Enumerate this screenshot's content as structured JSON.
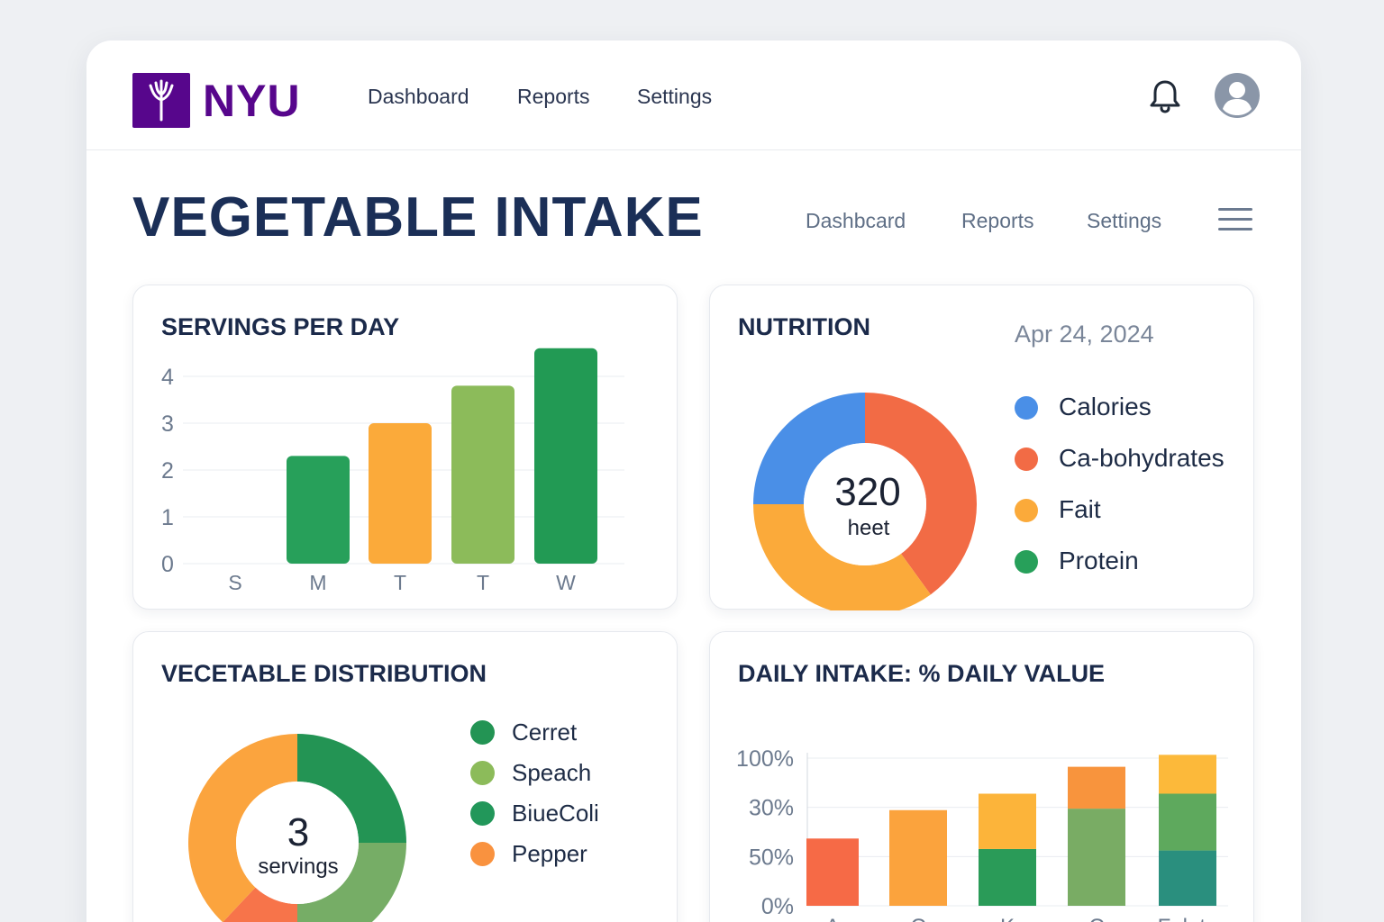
{
  "header": {
    "logo_text": "NYU",
    "nav": [
      "Dashboard",
      "Reports",
      "Settings"
    ]
  },
  "page": {
    "title": "VEGETABLE INTAKE",
    "subnav": [
      "Dashbcard",
      "Reports",
      "Settings"
    ]
  },
  "servings_card": {
    "title": "SERVINGS PER DAY"
  },
  "nutrition_card": {
    "title": "NUTRITION",
    "date": "Apr 24, 2024",
    "center_value": "320",
    "center_label": "heet",
    "legend": [
      {
        "label": "Calories",
        "color": "#4a8fe7"
      },
      {
        "label": "Ca-bohydrates",
        "color": "#f26b45"
      },
      {
        "label": "Fait",
        "color": "#fbaa3a"
      },
      {
        "label": "Protein",
        "color": "#27a05a"
      }
    ]
  },
  "distribution_card": {
    "title": "VECETABLE DISTRIBUTION",
    "center_value": "3",
    "center_label": "servings",
    "legend": [
      {
        "label": "Cerret",
        "color": "#239454"
      },
      {
        "label": "Speach",
        "color": "#8cbb5a"
      },
      {
        "label": "BiueColi",
        "color": "#22975a"
      },
      {
        "label": "Pepper",
        "color": "#f9923f"
      }
    ]
  },
  "daily_card": {
    "title": "DAILY INTAKE: % DAILY VALUE"
  },
  "chart_data": [
    {
      "type": "bar",
      "title": "SERVINGS PER DAY",
      "categories": [
        "S",
        "M",
        "T",
        "T",
        "W"
      ],
      "values": [
        0,
        2.3,
        3.0,
        3.8,
        4.6
      ],
      "colors": [
        "#27a05a",
        "#27a05a",
        "#fbaa3a",
        "#8cbb5a",
        "#229a54"
      ],
      "yticks": [
        "0",
        "1",
        "2",
        "3",
        "4"
      ],
      "ylim": [
        0,
        4.6
      ],
      "grid": true
    },
    {
      "type": "pie",
      "title": "NUTRITION",
      "categories": [
        "Calories",
        "Ca-bohydrates",
        "Fait",
        "Protein"
      ],
      "values": [
        25,
        40,
        35,
        0
      ],
      "colors": [
        "#4a8fe7",
        "#f26b45",
        "#fbaa3a",
        "#27a05a"
      ]
    },
    {
      "type": "pie",
      "title": "VECETABLE DISTRIBUTION",
      "categories": [
        "Cerret",
        "Speach",
        "Pepper",
        "Pepper"
      ],
      "values": [
        25,
        25,
        12,
        38
      ],
      "colors": [
        "#239454",
        "#76ad66",
        "#f7744a",
        "#fba43e"
      ]
    },
    {
      "type": "bar",
      "title": "DAILY INTAKE: % DAILY VALUE",
      "categories": [
        "A",
        "C",
        "K",
        "C",
        "Folate"
      ],
      "yticks": [
        "0%",
        "50%",
        "30%",
        "100%"
      ],
      "stacked": true,
      "grid": true,
      "ylim": [
        0,
        100
      ],
      "series": [
        {
          "values": [
            45,
            64,
            38,
            65,
            37
          ],
          "colors": [
            "#f66a46",
            "#fba33d",
            "#2a9b58",
            "#79ac64",
            "#2a8f7e"
          ]
        },
        {
          "values": [
            0,
            0,
            37,
            0,
            38
          ],
          "colors": [
            "#f66a46",
            "#fba33d",
            "#fcb43a",
            "#79ac64",
            "#5ea95d"
          ]
        },
        {
          "values": [
            0,
            0,
            0,
            28,
            26
          ],
          "colors": [
            "#f66a46",
            "#fba33d",
            "#fcb43a",
            "#f8943d",
            "#fcb93a"
          ]
        }
      ]
    }
  ]
}
